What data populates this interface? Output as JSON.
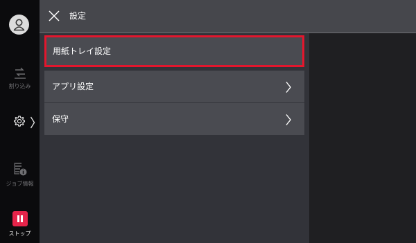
{
  "header": {
    "title": "設定"
  },
  "sidebar": {
    "interrupt_label": "割り込み",
    "jobinfo_label": "ジョブ情報",
    "stop_label": "ストップ"
  },
  "menu": {
    "items": [
      {
        "label": "用紙トレイ設定",
        "selected": true
      },
      {
        "label": "アプリ設定"
      },
      {
        "label": "保守"
      }
    ]
  },
  "colors": {
    "highlight_border": "#e3162d",
    "stop_button": "#e6244a"
  }
}
